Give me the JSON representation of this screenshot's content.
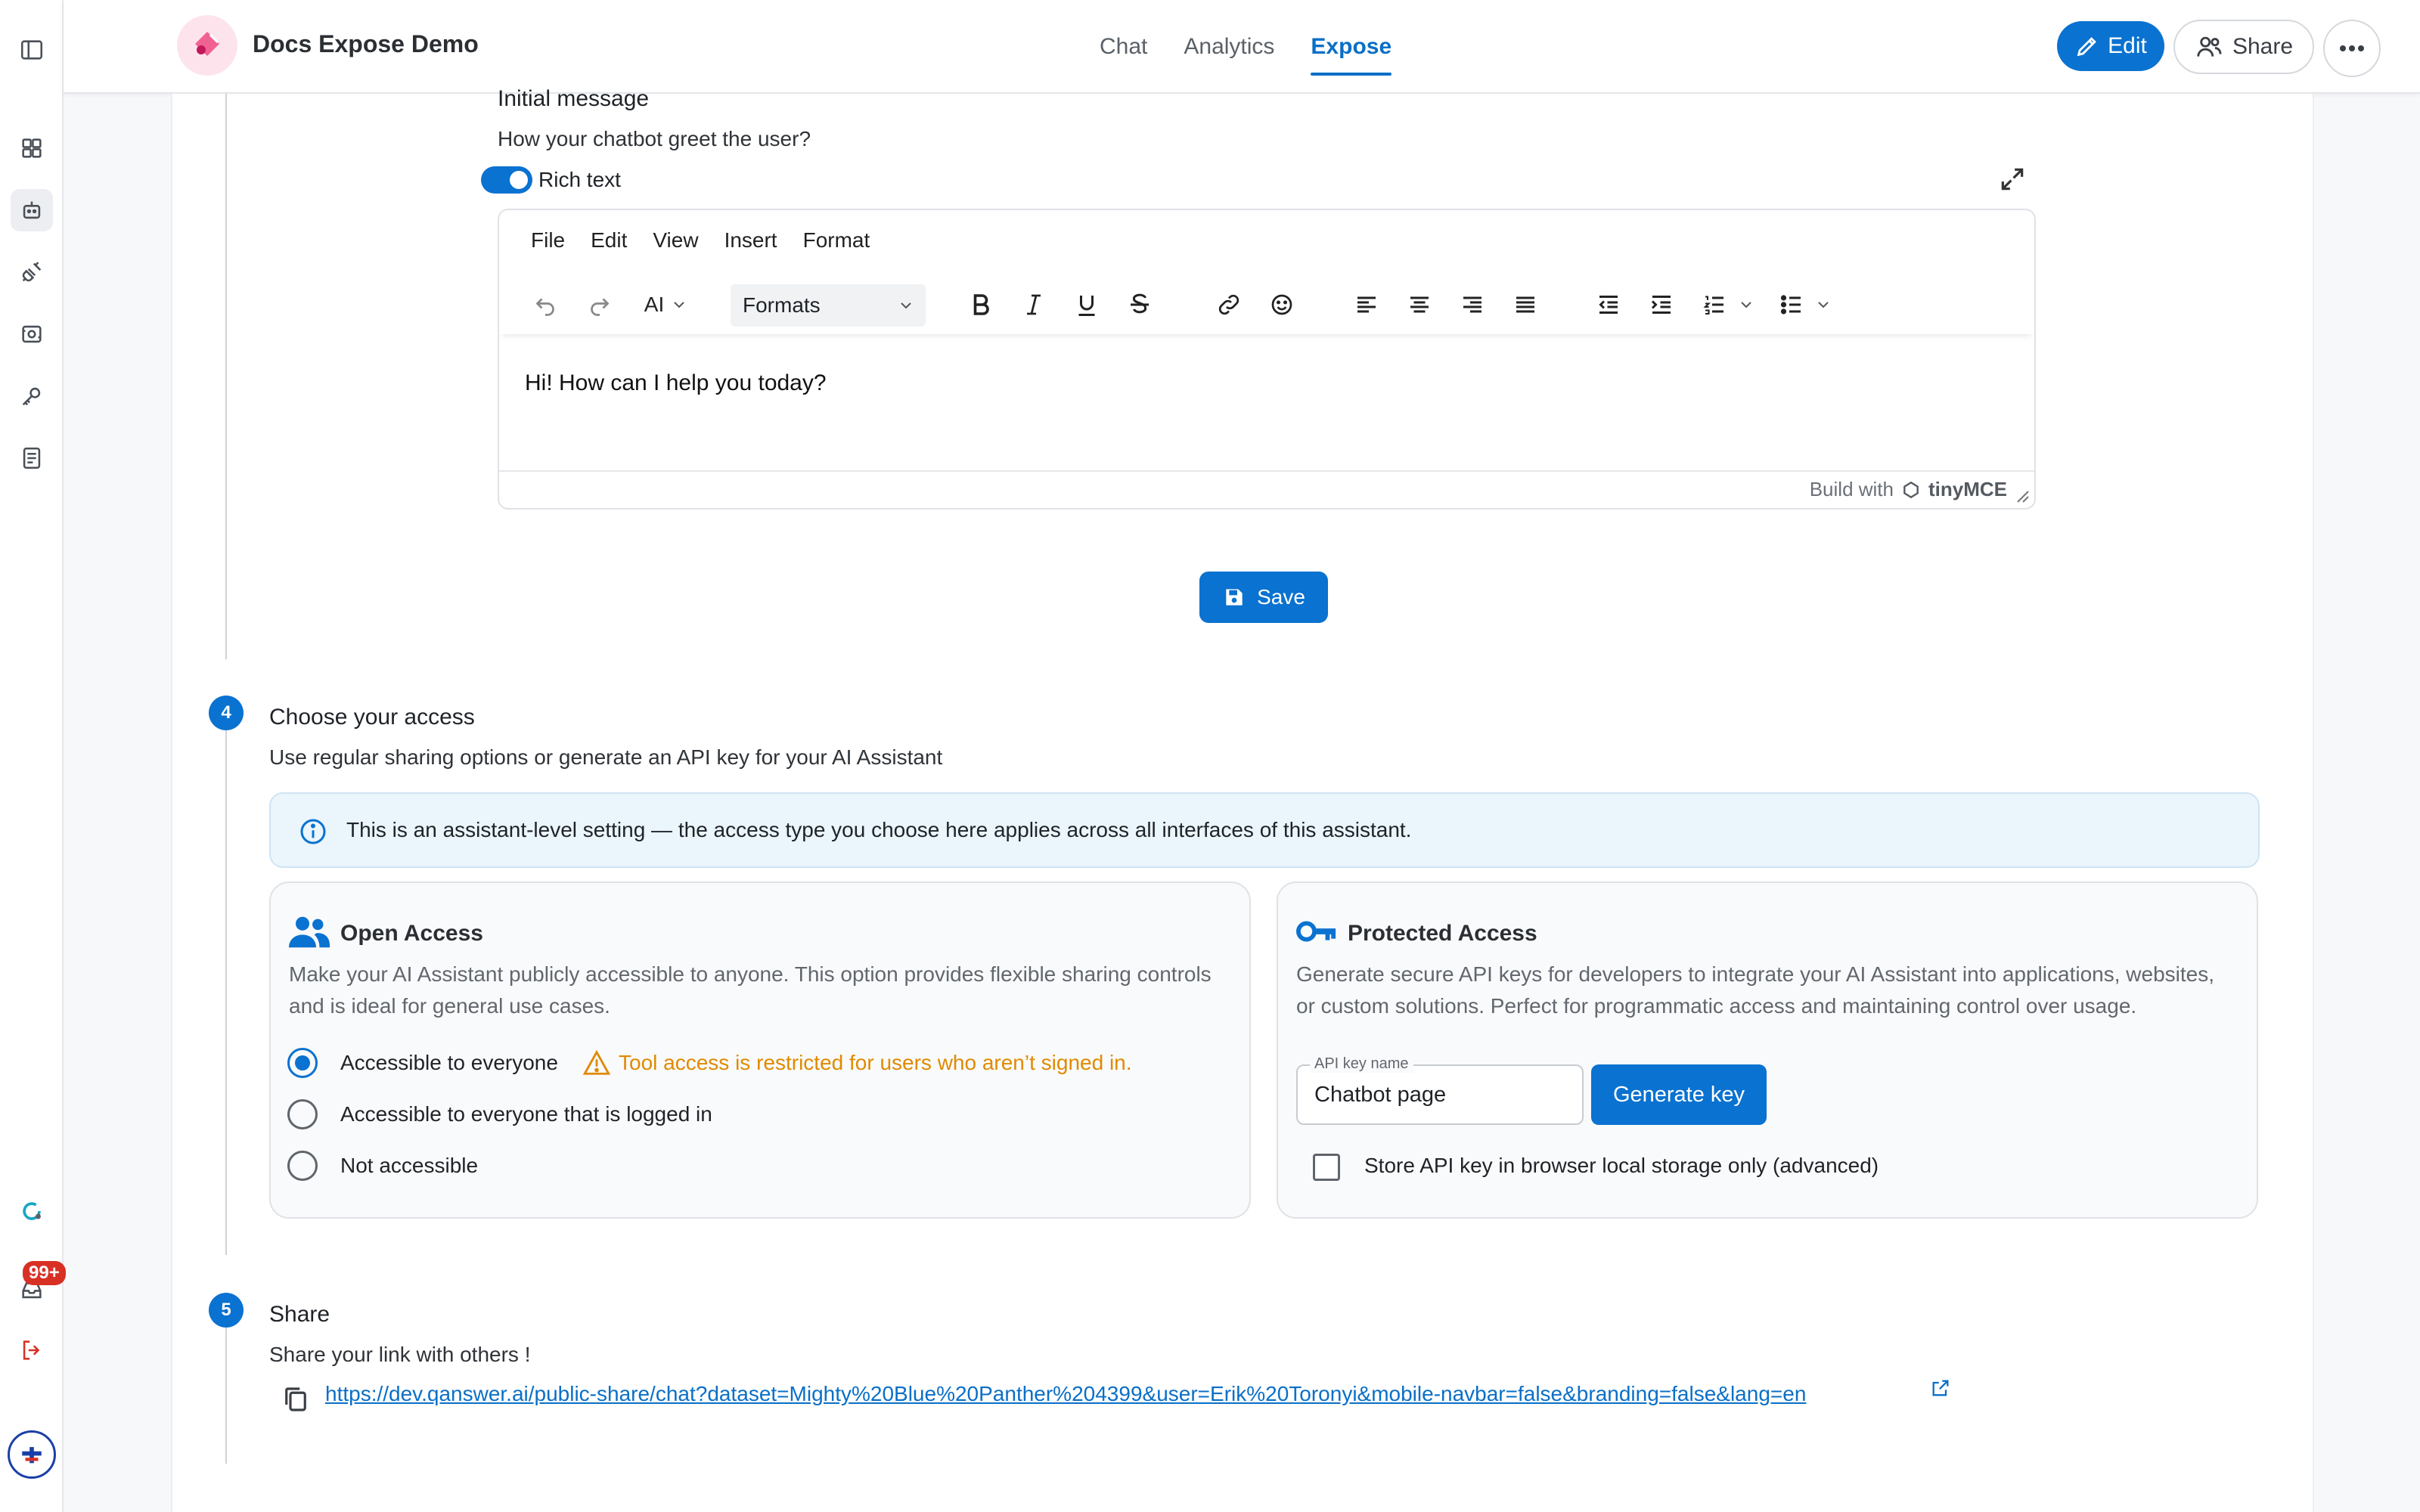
{
  "app": {
    "title": "Docs Expose Demo",
    "accent": "#0a72d0"
  },
  "header": {
    "tabs": [
      {
        "label": "Chat",
        "active": false
      },
      {
        "label": "Analytics",
        "active": false
      },
      {
        "label": "Expose",
        "active": true
      }
    ],
    "edit_label": "Edit",
    "share_label": "Share"
  },
  "sidebar": {
    "icons": [
      "sidebar-toggle-icon",
      "dashboard-icon",
      "robot-icon",
      "plug-icon",
      "media-icon",
      "key-icon",
      "document-icon",
      "support-icon",
      "inbox-icon",
      "logout-icon",
      "avatar-icon"
    ],
    "inbox_badge": "99+"
  },
  "initial_message": {
    "title": "Initial message",
    "subtitle": "How your chatbot greet the user?",
    "rich_text_label": "Rich text",
    "rich_text_on": true
  },
  "editor": {
    "menu": [
      "File",
      "Edit",
      "View",
      "Insert",
      "Format"
    ],
    "ai_label": "AI",
    "formats_label": "Formats",
    "content": "Hi! How can I help you today?",
    "footer_prefix": "Build with",
    "footer_brand": "tinyMCE"
  },
  "save_label": "Save",
  "access": {
    "step": "4",
    "title": "Choose your access",
    "subtitle": "Use regular sharing options or generate an API key for your AI Assistant",
    "info": "This is an assistant-level setting — the access type you choose here applies across all interfaces of this assistant.",
    "open": {
      "title": "Open Access",
      "description": "Make your AI Assistant publicly accessible to anyone. This option provides flexible sharing controls and is ideal for general use cases.",
      "options": [
        {
          "label": "Accessible to everyone",
          "selected": true
        },
        {
          "label": "Accessible to everyone that is logged in",
          "selected": false
        },
        {
          "label": "Not accessible",
          "selected": false
        }
      ],
      "warning": "Tool access is restricted for users who aren’t signed in."
    },
    "protected": {
      "title": "Protected Access",
      "description": "Generate secure API keys for developers to integrate your AI Assistant into applications, websites, or custom solutions. Perfect for programmatic access and maintaining control over usage.",
      "field_label": "API key name",
      "field_value": "Chatbot page",
      "generate_label": "Generate key",
      "store_label": "Store API key in browser local storage only (advanced)",
      "store_checked": false
    }
  },
  "share": {
    "step": "5",
    "title": "Share",
    "subtitle": "Share your link with others !",
    "url": "https://dev.qanswer.ai/public-share/chat?dataset=Mighty%20Blue%20Panther%204399&user=Erik%20Toronyi&mobile-navbar=false&branding=false&lang=en"
  }
}
